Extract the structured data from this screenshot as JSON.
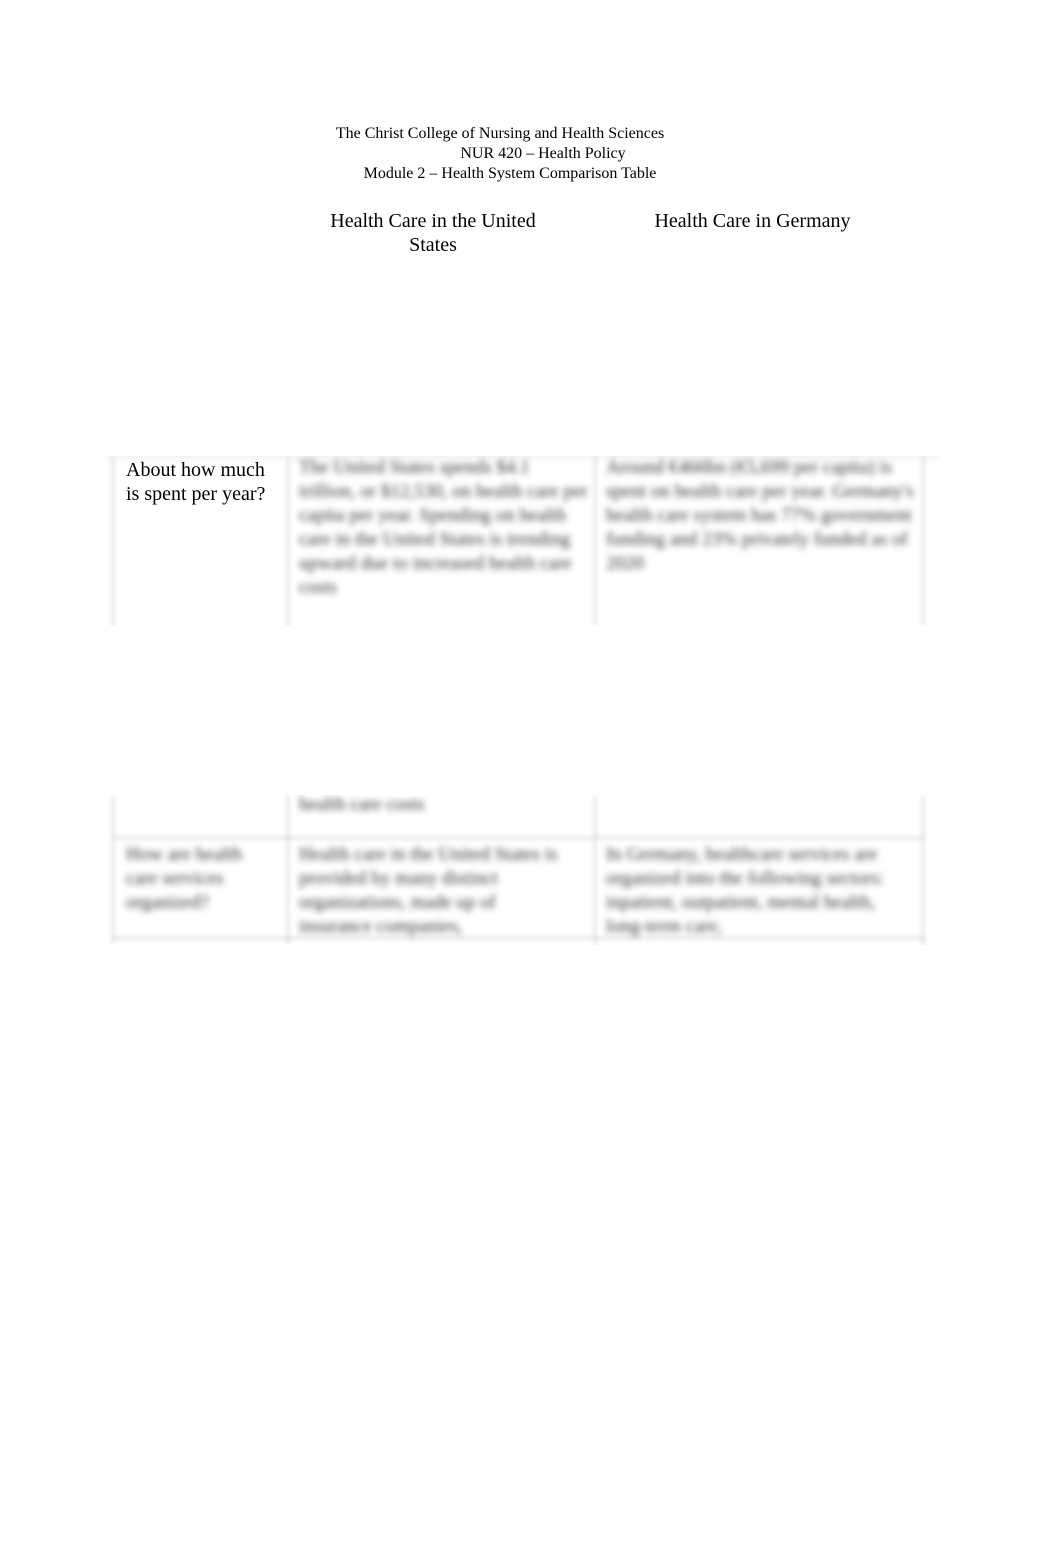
{
  "header": {
    "institution": "The Christ College of Nursing and Health Sciences",
    "course": "NUR 420 – Health Policy",
    "assignment": "Module 2 – Health System Comparison Table"
  },
  "table": {
    "columns": [
      "Health Care in the United States",
      "Health Care in Germany"
    ],
    "rows": [
      {
        "question": "About how much is spent per year?",
        "us_answer": "The United States spends $4.1 trillion, or $12,530, on health care per capita per year. Spending on health care in the United States is trending upward due to increased health care costs",
        "germany_answer": "Around €466bn (€5,699 per capita) is spent on health care per year. Germany's health care system has 77% government funding and 23% privately funded as of 2020"
      },
      {
        "question": "How are health care services organized?",
        "us_answer": "Health care in the United States is provided by many distinct organizations, made up of insurance companies,",
        "germany_answer": "In Germany, healthcare services are organized into the following sectors: inpatient, outpatient, mental health, long-term care,"
      }
    ]
  }
}
